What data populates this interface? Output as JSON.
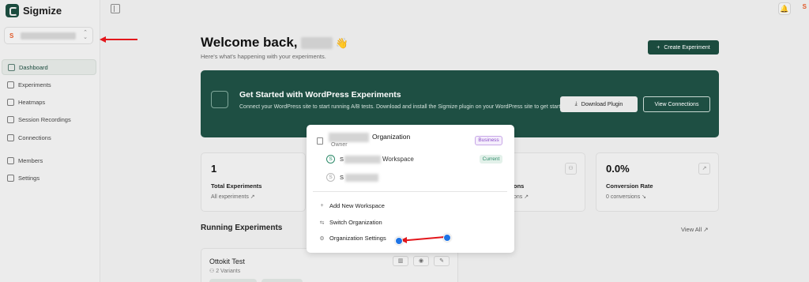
{
  "app": {
    "name": "Sigmize"
  },
  "sidebar": {
    "workspace_initial": "S",
    "items": [
      {
        "label": "Dashboard",
        "icon": "dashboard-icon",
        "active": true
      },
      {
        "label": "Experiments",
        "icon": "experiments-icon"
      },
      {
        "label": "Heatmaps",
        "icon": "heatmap-icon"
      },
      {
        "label": "Session Recordings",
        "icon": "video-icon"
      },
      {
        "label": "Connections",
        "icon": "link-icon"
      },
      {
        "label": "Members",
        "icon": "users-icon"
      },
      {
        "label": "Settings",
        "icon": "gear-icon"
      }
    ]
  },
  "topbar": {
    "avatar_initial": "S"
  },
  "header": {
    "welcome": "Welcome back,",
    "wave": "👋",
    "subtitle": "Here's what's happening with your experiments.",
    "create_button": "Create Experiment",
    "create_icon": "+"
  },
  "wp_banner": {
    "title": "Get Started with WordPress Experiments",
    "description": "Connect your WordPress site to start running A/B tests. Download and install the Sigmize plugin on your WordPress site to get started.",
    "download_button": "Download Plugin",
    "view_button": "View Connections"
  },
  "stats": [
    {
      "value": "1",
      "label": "Total Experiments",
      "link": "All experiments ↗"
    },
    {
      "label": "ons",
      "link": "ons ↗"
    },
    {
      "value": "0.0%",
      "label": "Conversion Rate",
      "link": "0 conversions ↘"
    }
  ],
  "running": {
    "title": "Running Experiments",
    "view_all": "View All ↗",
    "experiment": {
      "name": "Ottokit Test",
      "variants": "⚇ 2 Variants"
    }
  },
  "popup": {
    "org_label": "Organization",
    "role": "Owner",
    "plan_badge": "Business",
    "workspaces": [
      {
        "initial": "S",
        "name_visible": "Workspace",
        "badge": "Current",
        "prefix": "S"
      },
      {
        "initial": "S",
        "prefix": "S"
      }
    ],
    "menu": [
      {
        "icon": "+",
        "label": "Add New Workspace"
      },
      {
        "icon": "⇆",
        "label": "Switch Organization"
      },
      {
        "icon": "⚙",
        "label": "Organization Settings"
      }
    ]
  },
  "colors": {
    "brand": "#1b4b3e",
    "annotation_red": "#e3171c",
    "annotation_blue": "#1e74e6"
  }
}
